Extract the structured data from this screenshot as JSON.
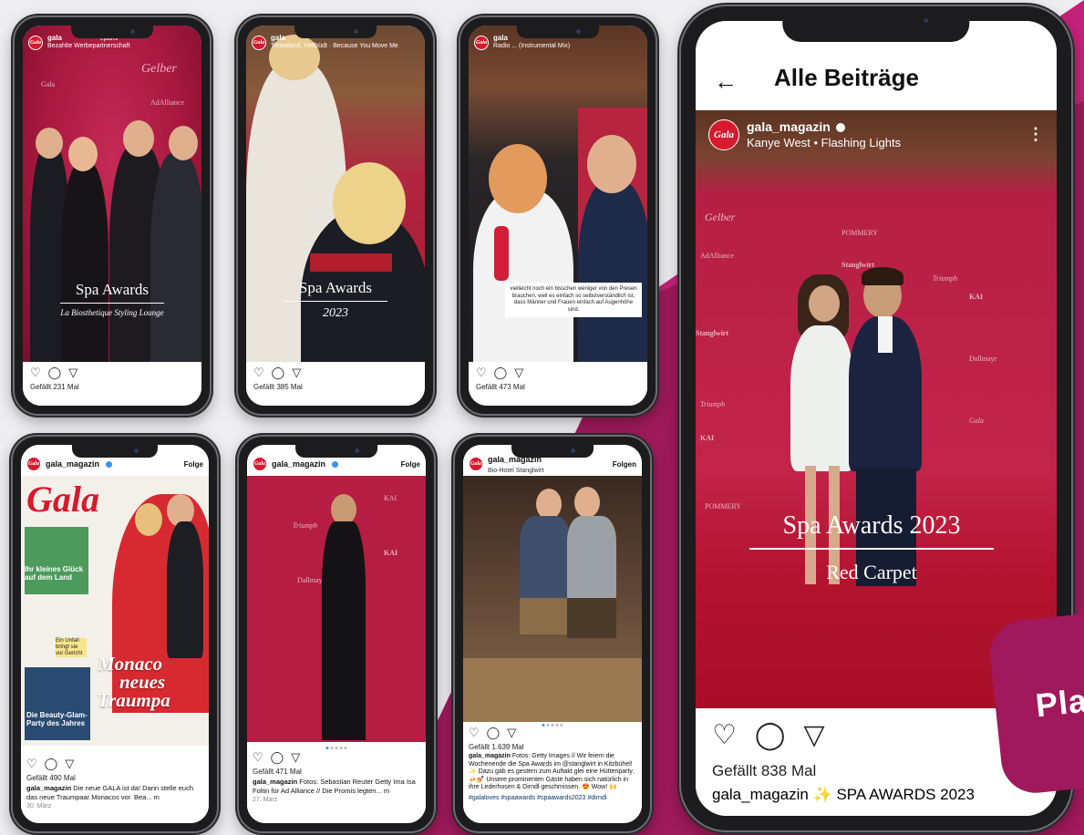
{
  "reels": [
    {
      "account": "gala",
      "audio": "Bezahlte Werbepartnerschaft",
      "audio_extra": "eparis",
      "title": "Spa Awards",
      "subtitle": "La Biosthetique Styling Lounge",
      "likes": "Gefällt 231 Mal"
    },
    {
      "account": "gala",
      "audio": "Timbaland, Hellbüdt · Because You Move Me",
      "title": "Spa Awards",
      "subtitle": "2023",
      "likes": "Gefällt 385 Mal"
    },
    {
      "account": "gala",
      "audio": "Radio ... (Instrumental Mix)",
      "quote": "vielleicht noch ein bisschen weniger von den Presen brauchen, weil es einfach so selbstverständlich ist, dass Männer und Frauen einfach auf Augenhöhe sind.",
      "likes": "Gefällt 473 Mal"
    }
  ],
  "posts": [
    {
      "account": "gala_magazin",
      "follow": "Folge",
      "magazine": {
        "masthead": "Gala",
        "headline_1": "Monaco",
        "headline_2": "neues",
        "headline_3": "Traumpa",
        "side_1": "Ihr kleines Glück auf dem Land",
        "side_2": "Die Beauty-Glam-Party des Jahres",
        "side_3": "Ein Unfall bringt sie vor Gericht"
      },
      "likes": "Gefällt 490 Mal",
      "caption_user": "gala_magazin",
      "caption": " Die neue GALA ist da! Darin stelle euch das neue Traumpaar Monacos vor. Bea... m",
      "date": "30. März"
    },
    {
      "account": "gala_magazin",
      "follow": "Folge",
      "likes": "Gefällt 471 Mal",
      "caption_user": "gala_magazin",
      "caption": " Fotos: Sebastian Reuter Getty Ima Isa Foltin für Ad Alliance // Die Promis legten... m",
      "date": "27. März"
    },
    {
      "account": "gala_magazin",
      "location": "Bio-Hotel Stanglwirt",
      "follow": "Folgen",
      "likes": "Gefällt 1.639 Mal",
      "caption_user": "gala_magazin",
      "caption": " Fotos: Getty Images // Wir feiern die Wochenende die Spa Awards im @stanglwirt in Kitzbühel! ✨ Dazu gab es gestern zum Auftakt glei eine Hüttenparty. 🍻💅 Unsere prominenten Gäste haben sich natürlich in ihre Lederhosen & Dirndl geschmissen. 😍 Wow! 🙌",
      "hashtags": "#galaloves #spaawards #spaawards2023 #dirndl"
    }
  ],
  "featured": {
    "header_title": "Alle Beiträge",
    "account": "gala_magazin",
    "audio": "Kanye West • Flashing Lights",
    "title": "Spa Awards 2023",
    "subtitle": "Red Carpet",
    "likes": "Gefällt 838 Mal",
    "caption_user": "gala_magazin",
    "caption": " ✨ SPA AWARDS 2023"
  },
  "wall_logos": [
    "POMMERY",
    "Stanglwirt",
    "Triumph",
    "KAI",
    "Dallmayr",
    "AdAlliance",
    "Gala",
    "Gelber"
  ],
  "side_label": "Pla",
  "colors": {
    "magenta": "#a0195c",
    "carpet": "#b61f44",
    "gala_red": "#d7192e"
  }
}
